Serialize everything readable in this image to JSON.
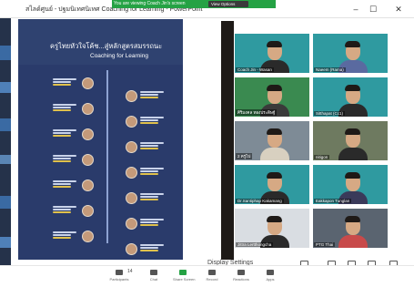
{
  "window": {
    "title": "สไลด์ศูนย์ - ปฐมนิเทศนิเทศ Coaching for Learning - PowerPoint",
    "zoom_notice": "You are viewing Coach Jin's screen",
    "view_options": "View Options",
    "minimize": "–",
    "maximize": "☐",
    "close": "✕"
  },
  "poster": {
    "title": "ครูไทยหัวใจโค้ช...สู่หลักสูตรสมรรถนะ",
    "subtitle": "Coaching for Learning"
  },
  "gallery": {
    "participants": [
      {
        "name": "Coach Jin - Wasan"
      },
      {
        "name": "Naeem (Rama)"
      },
      {
        "name": "ศิริมงคล ทองประดิษฐ์"
      },
      {
        "name": "Sitthapat (Cc1)"
      },
      {
        "name": "2 ครูไป"
      },
      {
        "name": "nitigon"
      },
      {
        "name": "Dr.Santiphap Kakamang"
      },
      {
        "name": "Eakkapon Tunglan"
      },
      {
        "name": "Jittra Lertthongcha"
      },
      {
        "name": "PTG Thai"
      }
    ]
  },
  "controls": {
    "display_settings": "Display Settings",
    "participants_count": "14",
    "toolbar": [
      {
        "label": "Participants",
        "icon": "participants-icon"
      },
      {
        "label": "Chat",
        "icon": "chat-icon"
      },
      {
        "label": "Share Screen",
        "icon": "share-screen-icon"
      },
      {
        "label": "Record",
        "icon": "record-icon"
      },
      {
        "label": "Reactions",
        "icon": "reactions-icon"
      },
      {
        "label": "Apps",
        "icon": "apps-icon"
      }
    ]
  },
  "colors": {
    "zoom_green": "#25a244",
    "poster_bg": "#2a3b6b",
    "gallery_teal": "#2f9aa0"
  }
}
